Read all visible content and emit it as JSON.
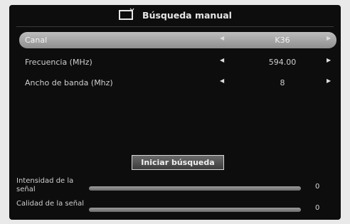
{
  "title": "Búsqueda manual",
  "icon": "tv-icon",
  "rows": [
    {
      "label": "Canal",
      "value": "K36",
      "selected": true
    },
    {
      "label": "Frecuencia (MHz)",
      "value": "594.00",
      "selected": false
    },
    {
      "label": "Ancho de banda (Mhz)",
      "value": "8",
      "selected": false
    }
  ],
  "start_button": "Iniciar búsqueda",
  "meters": [
    {
      "label": "Intensidad de la señal",
      "value": "0",
      "level": 0
    },
    {
      "label": "Calidad de la señal",
      "value": "0",
      "level": 0
    }
  ],
  "colors": {
    "background": "#0d0d0d",
    "selected_row": "#a9a9a9",
    "meter_track": "#8a8a8a"
  }
}
